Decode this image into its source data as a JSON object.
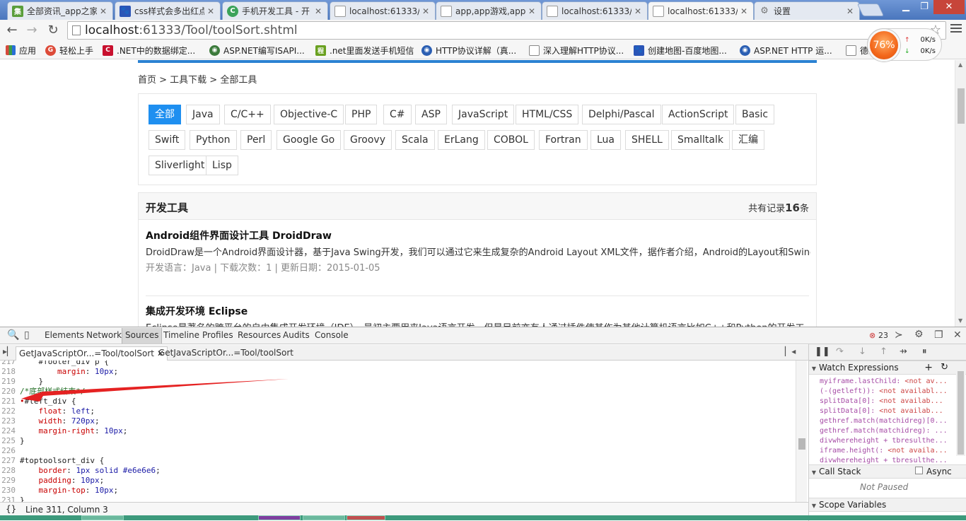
{
  "browser": {
    "tabs": [
      {
        "title": "全部资讯_app之家",
        "favicon": "集",
        "color": "#5a9e3b"
      },
      {
        "title": "css样式会多出红点",
        "favicon": "🐾",
        "color": "#2a55b7"
      },
      {
        "title": "手机开发工具 - 开",
        "favicon": "C",
        "color": "#3ca35a"
      },
      {
        "title": "localhost:61333/",
        "favicon": "",
        "color": "#ffffff"
      },
      {
        "title": "app,app游戏,app",
        "favicon": "",
        "color": "#ffffff"
      },
      {
        "title": "localhost:61333/",
        "favicon": "",
        "color": "#ffffff"
      },
      {
        "title": "localhost:61333/",
        "favicon": "",
        "color": "#ffffff"
      },
      {
        "title": "设置",
        "favicon": "⚙",
        "color": "#777777"
      }
    ],
    "url_host": "localhost",
    "url_path": ":61333/Tool/toolSort.shtml",
    "bookmarks": [
      {
        "label": "应用",
        "color": "#d64a3c"
      },
      {
        "label": "轻松上手",
        "color": "#dd4b39"
      },
      {
        "label": ".NET中的数据绑定...",
        "color": "#c8102e"
      },
      {
        "label": "ASP.NET编写ISAPI...",
        "color": "#3b7a3b"
      },
      {
        "label": ".net里面发送手机短信",
        "color": "#6aa121"
      },
      {
        "label": "HTTP协议详解（真...",
        "color": "#2b5fb3"
      },
      {
        "label": "深入理解HTTP协议...",
        "color": "#ffffff"
      },
      {
        "label": "创建地图-百度地图...",
        "color": "#2a55b7"
      },
      {
        "label": "ASP.NET HTTP 运...",
        "color": "#2b5fb3"
      },
      {
        "label": "德",
        "color": "#ffffff"
      }
    ],
    "speed": {
      "percent": "76%",
      "up": "0K/s",
      "down": "0K/s"
    }
  },
  "page": {
    "breadcrumb": "首页 > 工具下载 > 全部工具",
    "languages_row1": [
      "全部",
      "Java",
      "C/C++",
      "Objective-C",
      "PHP",
      "C#",
      "ASP",
      "JavaScript",
      "HTML/CSS",
      "Delphi/Pascal",
      "ActionScript",
      "Basic"
    ],
    "languages_row2": [
      "Swift",
      "Python",
      "Perl",
      "Google Go",
      "Groovy",
      "Scala",
      "ErLang",
      "COBOL",
      "Fortran",
      "Lua",
      "SHELL",
      "Smalltalk",
      "汇编"
    ],
    "languages_row3": [
      "Sliverlight",
      "Lisp"
    ],
    "list_title": "开发工具",
    "count_prefix": "共有记录",
    "count_value": "16",
    "count_suffix": "条",
    "items": [
      {
        "title": "Android组件界面设计工具 DroidDraw",
        "desc": "DroidDraw是一个Android界面设计器，基于Java Swing开发，我们可以通过它来生成复杂的Android Layout XML文件，据作者介绍，Android的Layout和Swing",
        "meta": "开发语言：Java | 下载次数：1 | 更新日期：2015-01-05"
      },
      {
        "title": "集成开发环境 Eclipse",
        "desc": "Eclipse是著名的跨平台的自由集成开发环境（IDE）。最初主要用来Java语言开发，但是目前亦有人通过插件使其作为其他计算机语言比如C++和Python的开发工",
        "meta": ""
      }
    ]
  },
  "devtools": {
    "tabs": [
      "Elements",
      "Network",
      "Sources",
      "Timeline",
      "Profiles",
      "Resources",
      "Audits",
      "Console"
    ],
    "selected_tab": "Sources",
    "error_count": "23",
    "file_tabs": [
      "GetJavaScriptOr...=Tool/toolSort",
      "GetJavaScriptOr...=Tool/toolSort"
    ],
    "code_lines": [
      {
        "n": "217",
        "t": "    #footer_div p {"
      },
      {
        "n": "218",
        "t": "        margin: 10px;"
      },
      {
        "n": "219",
        "t": "    }"
      },
      {
        "n": "220",
        "t": "/*底部样式结束*/"
      },
      {
        "n": "221",
        "t": "•#left_div {"
      },
      {
        "n": "222",
        "t": "    float: left;"
      },
      {
        "n": "223",
        "t": "    width: 720px;"
      },
      {
        "n": "224",
        "t": "    margin-right: 10px;"
      },
      {
        "n": "225",
        "t": "}"
      },
      {
        "n": "226",
        "t": ""
      },
      {
        "n": "227",
        "t": "#toptoolsort_div {"
      },
      {
        "n": "228",
        "t": "    border: 1px solid #e6e6e6;"
      },
      {
        "n": "229",
        "t": "    padding: 10px;"
      },
      {
        "n": "230",
        "t": "    margin-top: 10px;"
      },
      {
        "n": "231",
        "t": "}"
      }
    ],
    "status": "Line 311, Column 3",
    "status_icon": "{}",
    "watch_title": "Watch Expressions",
    "watch": [
      {
        "expr": "myiframe.lastChild: ",
        "val": "<not av..."
      },
      {
        "expr": "(-(getleft)): ",
        "val": "<not availabl..."
      },
      {
        "expr": "splitData[0]: ",
        "val": "<not availab..."
      },
      {
        "expr": "splitData[0]: ",
        "val": "<not availab..."
      },
      {
        "expr": "gethref.match(matchidreg)[0...",
        "val": ""
      },
      {
        "expr": "gethref.match(matchidreg): ...",
        "val": ""
      },
      {
        "expr": "divwhereheight + tbresulthe...",
        "val": ""
      },
      {
        "expr": "iframe.height(: ",
        "val": "<not availa..."
      },
      {
        "expr": "divwhereheight + tbresulthe...",
        "val": ""
      }
    ],
    "call_stack_title": "Call Stack",
    "async_label": "Async",
    "not_paused": "Not Paused",
    "scope_title": "Scope Variables"
  }
}
